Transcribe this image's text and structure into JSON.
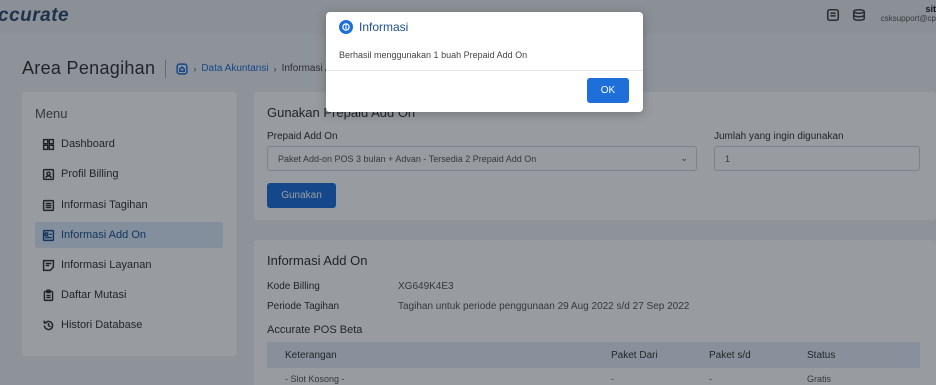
{
  "app": {
    "logo_text": "ccurate"
  },
  "topbar": {
    "user_name": "sit",
    "user_email": "csksupport@cp",
    "icons": [
      "document-icon",
      "database-icon"
    ]
  },
  "page": {
    "title": "Area Penagihan",
    "breadcrumb": {
      "home_icon": "home-icon",
      "link": "Data Akuntansi",
      "current": "Informasi Ad"
    }
  },
  "menu": {
    "title": "Menu",
    "items": [
      {
        "label": "Dashboard",
        "icon": "dashboard-icon",
        "active": false
      },
      {
        "label": "Profil Billing",
        "icon": "profile-icon",
        "active": false
      },
      {
        "label": "Informasi Tagihan",
        "icon": "invoice-icon",
        "active": false
      },
      {
        "label": "Informasi Add On",
        "icon": "addon-icon",
        "active": true
      },
      {
        "label": "Informasi Layanan",
        "icon": "service-icon",
        "active": false
      },
      {
        "label": "Daftar Mutasi",
        "icon": "clipboard-icon",
        "active": false
      },
      {
        "label": "Histori Database",
        "icon": "history-icon",
        "active": false
      }
    ]
  },
  "prepaid": {
    "title": "Gunakan Prepaid Add On",
    "select_label": "Prepaid Add On",
    "select_value": "Paket Add-on POS 3 bulan + Advan - Tersedia 2 Prepaid Add On",
    "qty_label": "Jumlah yang ingin digunakan",
    "qty_value": "1",
    "button_label": "Gunakan"
  },
  "addon_info": {
    "title": "Informasi Add On",
    "kode_label": "Kode Billing",
    "kode_value": "XG649K4E3",
    "periode_label": "Periode Tagihan",
    "periode_value": "Tagihan untuk periode penggunaan 29 Aug 2022 s/d 27 Sep 2022",
    "section_title": "Accurate POS Beta",
    "columns": [
      "Keterangan",
      "Paket Dari",
      "Paket s/d",
      "Status"
    ],
    "row": [
      "- Slot Kosong -",
      "-",
      "-",
      "Gratis"
    ]
  },
  "modal": {
    "title": "Informasi",
    "message": "Berhasil menggunakan 1 buah Prepaid Add On",
    "ok_label": "OK"
  }
}
